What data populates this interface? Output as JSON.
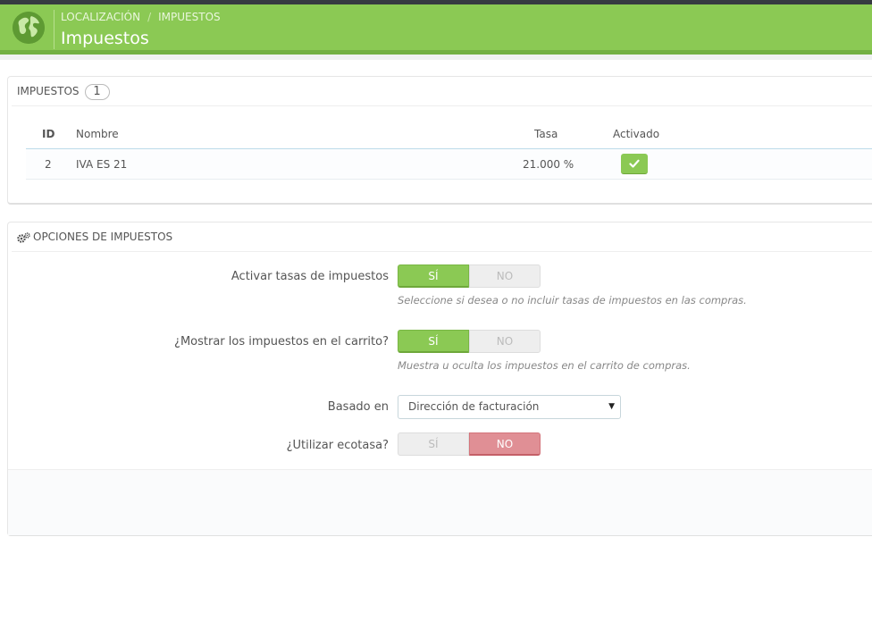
{
  "header": {
    "breadcrumb": [
      "LOCALIZACIÓN",
      "IMPUESTOS"
    ],
    "breadcrumb_sep": "/",
    "title": "Impuestos",
    "icon": "globe-icon",
    "brand_color": "#8bc954"
  },
  "taxes_panel": {
    "title": "IMPUESTOS",
    "count": "1",
    "columns": [
      "ID",
      "Nombre",
      "Tasa",
      "Activado"
    ],
    "rows": [
      {
        "id": "2",
        "name": "IVA ES 21",
        "rate": "21.000 %",
        "enabled": true
      }
    ]
  },
  "options_panel": {
    "title": "OPCIONES DE IMPUESTOS",
    "icon": "gears-icon",
    "fields": [
      {
        "label": "Activar tasas de impuestos",
        "yes": "SÍ",
        "no": "NO",
        "value": "yes",
        "help": "Seleccione si desea o no incluir tasas de impuestos en las compras."
      },
      {
        "label": "¿Mostrar los impuestos en el carrito?",
        "yes": "SÍ",
        "no": "NO",
        "value": "yes",
        "help": "Muestra u oculta los impuestos en el carrito de compras."
      },
      {
        "label": "Basado en",
        "selected": "Dirección de facturación"
      },
      {
        "label": "¿Utilizar ecotasa?",
        "yes": "SÍ",
        "no": "NO",
        "value": "no"
      }
    ]
  },
  "colors": {
    "yes_on": "#8bc954",
    "no_on": "#e08f95"
  }
}
